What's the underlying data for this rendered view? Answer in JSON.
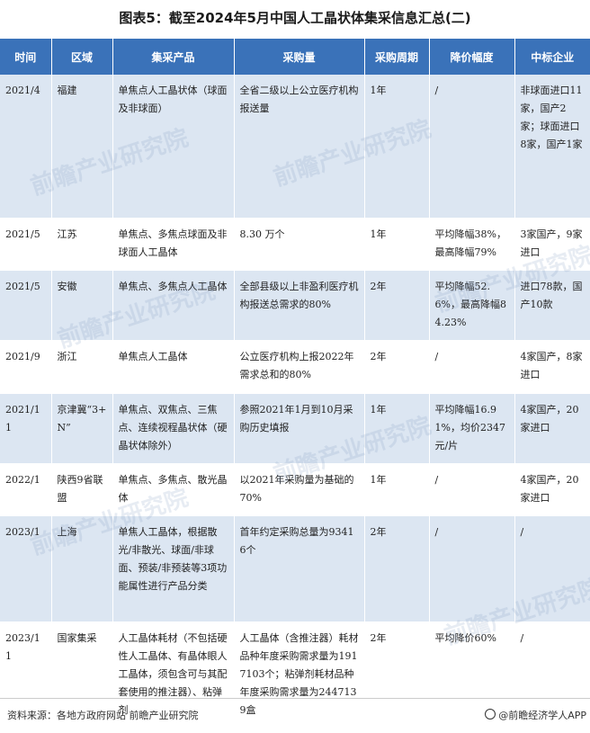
{
  "title": "图表5：截至2024年5月中国人工晶状体集采信息汇总(二)",
  "headers": [
    "时间",
    "区域",
    "集采产品",
    "采购量",
    "采购周期",
    "降价幅度",
    "中标企业"
  ],
  "rows": [
    [
      "2021/4",
      "福建",
      "单焦点人工晶状体（球面及非球面）",
      "全省二级以上公立医疗机构报送量",
      "1年",
      "/",
      "非球面进口11家，国产2家；球面进口8家，国产1家"
    ],
    [
      "2021/5",
      "江苏",
      "单焦点、多焦点球面及非球面人工晶体",
      "8.30 万个",
      "1年",
      "平均降幅38%，最高降幅79%",
      "3家国产，9家进口"
    ],
    [
      "2021/5",
      "安徽",
      "单焦点、多焦点人工晶体",
      "全部县级以上非盈利医疗机构报送总需求的80%",
      "2年",
      "平均降幅52.6%，最高降幅84.23%",
      "进口78款，国产10款"
    ],
    [
      "2021/9",
      "浙江",
      "单焦点人工晶体",
      "公立医疗机构上报2022年需求总和的80%",
      "2年",
      "/",
      "4家国产，8家进口"
    ],
    [
      "2021/11",
      "京津冀“3+N”",
      "单焦点、双焦点、三焦点、连续视程晶状体（硬晶状体除外）",
      "参照2021年1月到10月采购历史填报",
      "1年",
      "平均降幅16.91%，均价2347元/片",
      "4家国产，20家进口"
    ],
    [
      "2022/1",
      "陕西9省联盟",
      "单焦点、多焦点、散光晶体",
      "以2021年采购量为基础的70%",
      "1年",
      "/",
      "4家国产，20家进口"
    ],
    [
      "2023/1",
      "上海",
      "单焦人工晶体，根据散光/非散光、球面/非球面、预装/非预装等3项功能属性进行产品分类",
      "首年约定采购总量为93416个",
      "2年",
      "/",
      "/"
    ],
    [
      "2023/11",
      "国家集采",
      "人工晶体耗材（不包括硬性人工晶体、有晶体眼人工晶体，须包含可与其配套使用的推注器）、粘弹剂",
      "人工晶体（含推注器）耗材品种年度采购需求量为1917103个；粘弹剂耗材品种年度采购需求量为2447139盒",
      "2年",
      "平均降价60%",
      "/"
    ]
  ],
  "footer": {
    "source": "资料来源：各地方政府网站 前瞻产业研究院",
    "brand": "@前瞻经济学人APP"
  },
  "watermark": "前瞻产业研究院"
}
